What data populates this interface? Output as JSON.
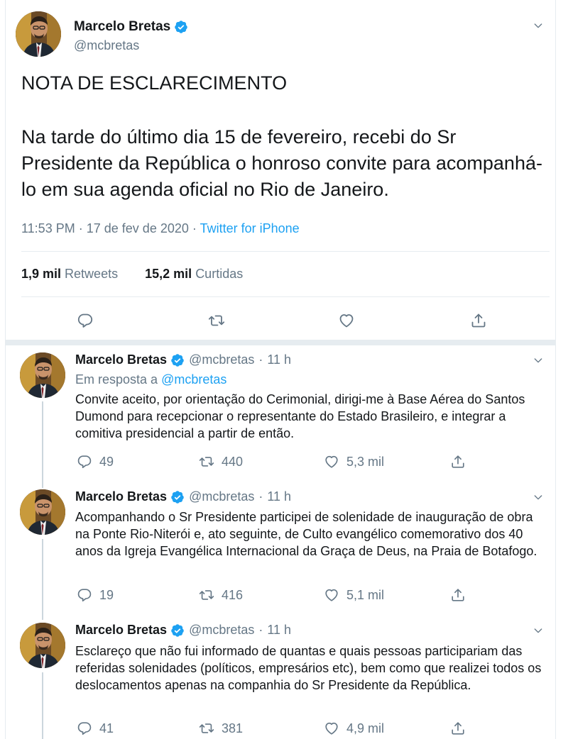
{
  "main_tweet": {
    "author_name": "Marcelo Bretas",
    "handle": "@mcbretas",
    "title_line": "NOTA DE ESCLARECIMENTO",
    "body": "Na tarde do último dia 15 de fevereiro, recebi do Sr Presidente da República o honroso convite para acompanhá-lo em sua agenda oficial no Rio de Janeiro.",
    "time": "11:53 PM",
    "date": "17 de fev de 2020",
    "source": "Twitter for iPhone",
    "retweets_count": "1,9 mil",
    "retweets_label": "Retweets",
    "likes_count": "15,2 mil",
    "likes_label": "Curtidas",
    "separator": "·"
  },
  "replies": [
    {
      "author_name": "Marcelo Bretas",
      "handle": "@mcbretas",
      "time": "11 h",
      "reply_to_label": "Em resposta a",
      "reply_to_mention": "@mcbretas",
      "text": "Convite aceito, por orientação do Cerimonial, dirigi-me à Base Aérea do Santos Dumond para recepcionar o representante do Estado Brasileiro, e integrar a comitiva presidencial a partir de então.",
      "replies": "49",
      "retweets": "440",
      "likes": "5,3 mil"
    },
    {
      "author_name": "Marcelo Bretas",
      "handle": "@mcbretas",
      "time": "11 h",
      "text": "Acompanhando o Sr Presidente participei de solenidade de inauguração de obra na Ponte Rio-Niterói e, ato seguinte, de Culto evangélico comemorativo dos 40 anos da Igreja Evangélica Internacional da Graça de Deus, na Praia de Botafogo.",
      "replies": "19",
      "retweets": "416",
      "likes": "5,1 mil"
    },
    {
      "author_name": "Marcelo Bretas",
      "handle": "@mcbretas",
      "time": "11 h",
      "text": "Esclareço que não fui informado de quantas e quais pessoas participariam das referidas solenidades (políticos, empresários etc), bem como que realizei todos os deslocamentos apenas na companhia do Sr Presidente da República.",
      "replies": "41",
      "retweets": "381",
      "likes": "4,9 mil"
    }
  ],
  "icons": {
    "verified": "verified-badge-icon",
    "reply": "reply-icon",
    "retweet": "retweet-icon",
    "like": "heart-icon",
    "share": "share-icon",
    "menu": "chevron-down-icon"
  },
  "colors": {
    "accent": "#1da1f2",
    "text": "#14171a",
    "muted": "#657786",
    "divider": "#e6ecf0"
  }
}
